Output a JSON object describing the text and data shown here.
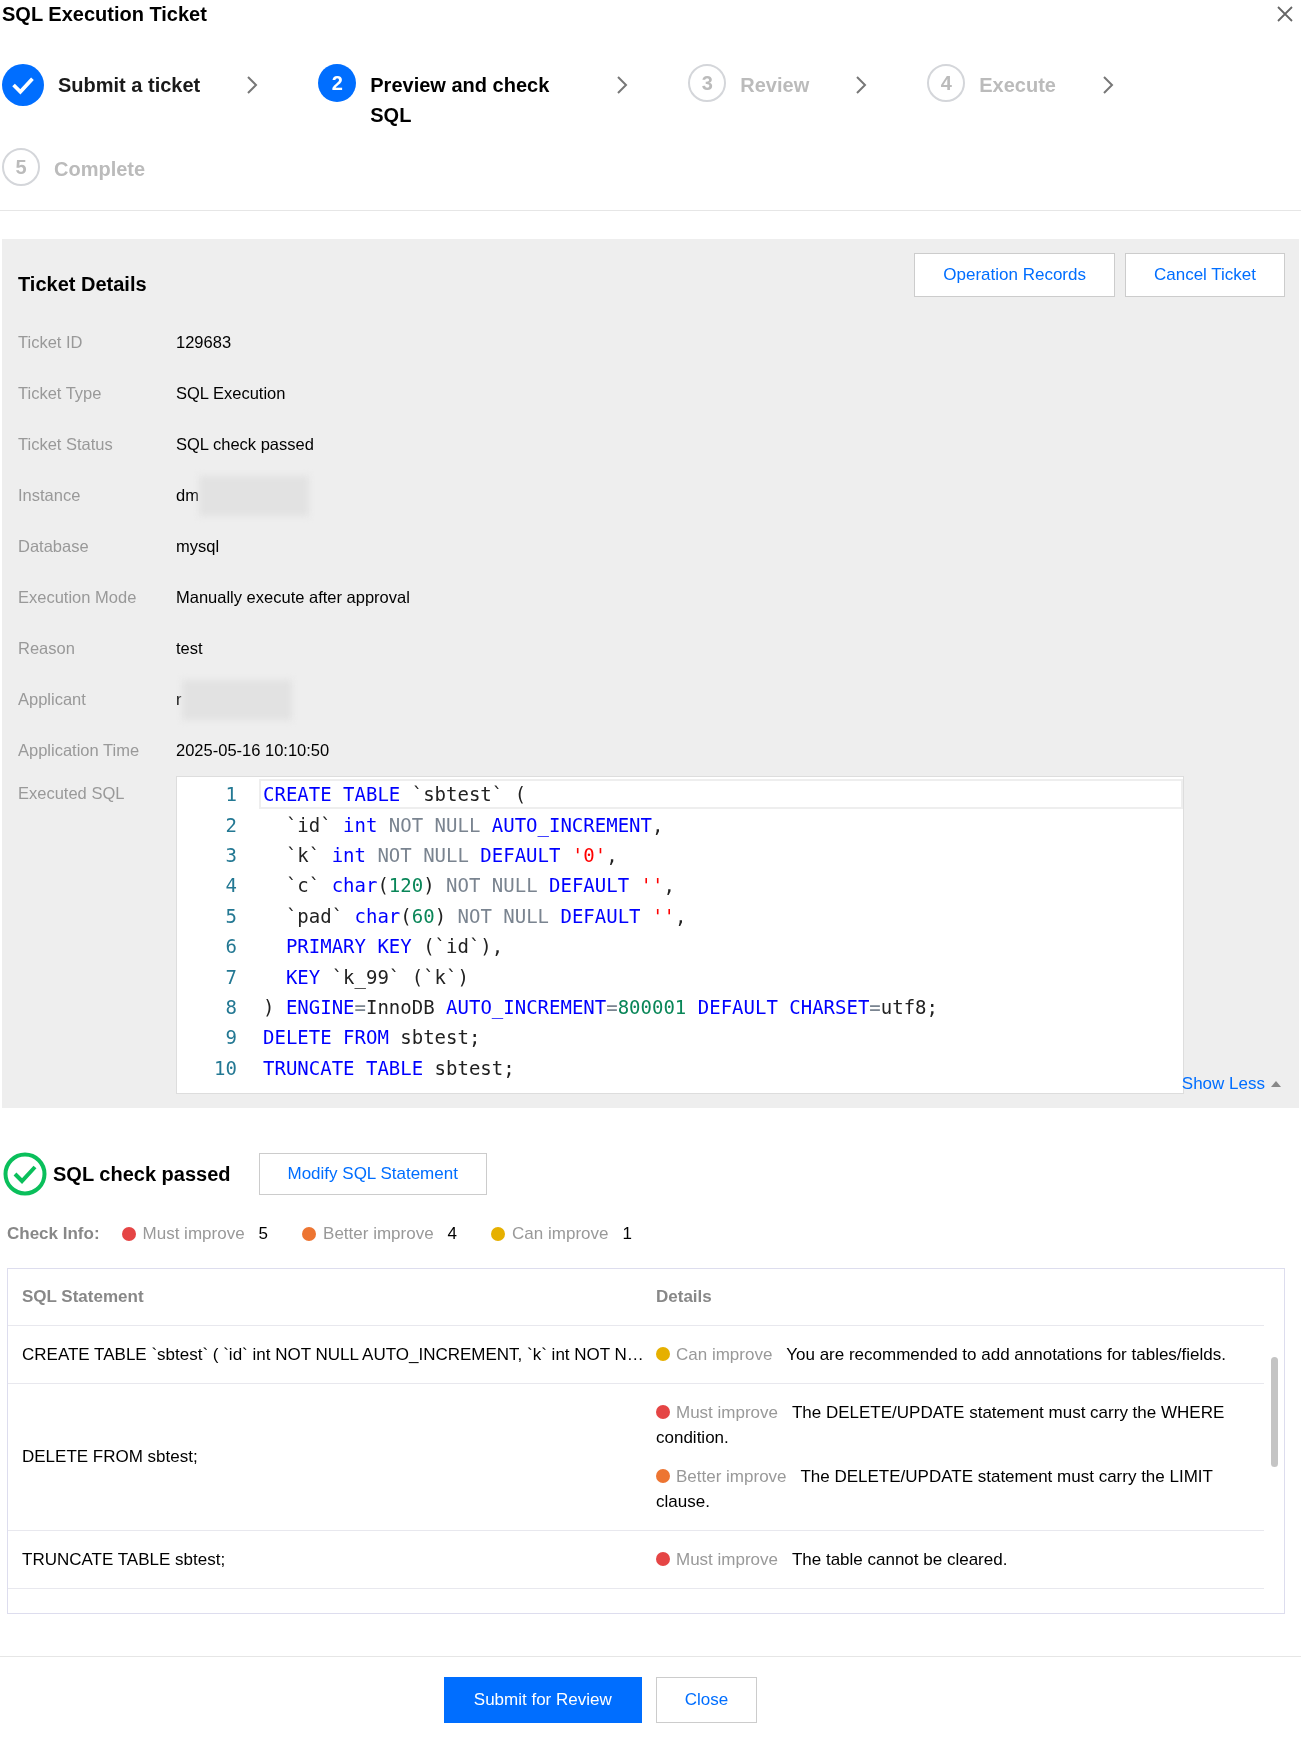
{
  "window": {
    "title": "SQL Execution Ticket"
  },
  "steps": [
    {
      "label": "Submit a ticket",
      "completed": true,
      "selected": false
    },
    {
      "number": "2",
      "label": "Preview and check SQL",
      "completed": false,
      "selected": true
    },
    {
      "number": "3",
      "label": "Review",
      "completed": false,
      "selected": false
    },
    {
      "number": "4",
      "label": "Execute",
      "completed": false,
      "selected": false
    },
    {
      "number": "5",
      "label": "Complete",
      "completed": false,
      "selected": false
    }
  ],
  "ticket_details": {
    "title": "Ticket Details",
    "buttons": [
      "Operation Records",
      "Cancel Ticket"
    ],
    "fields": [
      {
        "label": "Ticket ID",
        "value": "129683"
      },
      {
        "label": "Ticket Type",
        "value": "SQL Execution"
      },
      {
        "label": "Ticket Status",
        "value": "SQL check passed"
      },
      {
        "label": "Instance",
        "value": "dm",
        "redacted": true
      },
      {
        "label": "Database",
        "value": "mysql"
      },
      {
        "label": "Execution Mode",
        "value": "Manually execute after approval"
      },
      {
        "label": "Reason",
        "value": "test"
      },
      {
        "label": "Applicant",
        "value": "r",
        "redacted": true
      },
      {
        "label": "Application Time",
        "value": "2025-05-16 10:10:50"
      }
    ],
    "sql_label": "Executed SQL",
    "sql_lines": [
      {
        "number": "1",
        "active": true,
        "tokens": [
          {
            "kind": "kw",
            "text": "CREATE TABLE"
          },
          {
            "kind": "plain",
            "text": " `sbtest` ("
          }
        ]
      },
      {
        "number": "2",
        "active": false,
        "tokens": [
          {
            "kind": "plain",
            "text": "  `id` "
          },
          {
            "kind": "kw",
            "text": "int"
          },
          {
            "kind": "muted",
            "text": " NOT NULL "
          },
          {
            "kind": "kw",
            "text": "AUTO_INCREMENT"
          },
          {
            "kind": "plain",
            "text": ","
          }
        ]
      },
      {
        "number": "3",
        "active": false,
        "tokens": [
          {
            "kind": "plain",
            "text": "  `k` "
          },
          {
            "kind": "kw",
            "text": "int"
          },
          {
            "kind": "muted",
            "text": " NOT NULL "
          },
          {
            "kind": "kw",
            "text": "DEFAULT"
          },
          {
            "kind": "str",
            "text": " '0'"
          },
          {
            "kind": "plain",
            "text": ","
          }
        ]
      },
      {
        "number": "4",
        "active": false,
        "tokens": [
          {
            "kind": "plain",
            "text": "  `c` "
          },
          {
            "kind": "kw",
            "text": "char"
          },
          {
            "kind": "plain",
            "text": "("
          },
          {
            "kind": "num",
            "text": "120"
          },
          {
            "kind": "plain",
            "text": ")"
          },
          {
            "kind": "muted",
            "text": " NOT NULL "
          },
          {
            "kind": "kw",
            "text": "DEFAULT"
          },
          {
            "kind": "str",
            "text": " ''"
          },
          {
            "kind": "plain",
            "text": ","
          }
        ]
      },
      {
        "number": "5",
        "active": false,
        "tokens": [
          {
            "kind": "plain",
            "text": "  `pad` "
          },
          {
            "kind": "kw",
            "text": "char"
          },
          {
            "kind": "plain",
            "text": "("
          },
          {
            "kind": "num",
            "text": "60"
          },
          {
            "kind": "plain",
            "text": ")"
          },
          {
            "kind": "muted",
            "text": " NOT NULL "
          },
          {
            "kind": "kw",
            "text": "DEFAULT"
          },
          {
            "kind": "str",
            "text": " ''"
          },
          {
            "kind": "plain",
            "text": ","
          }
        ]
      },
      {
        "number": "6",
        "active": false,
        "tokens": [
          {
            "kind": "kw",
            "text": "  PRIMARY KEY"
          },
          {
            "kind": "plain",
            "text": " (`id`),"
          }
        ]
      },
      {
        "number": "7",
        "active": false,
        "tokens": [
          {
            "kind": "kw",
            "text": "  KEY"
          },
          {
            "kind": "plain",
            "text": " `k_99` (`k`)"
          }
        ]
      },
      {
        "number": "8",
        "active": false,
        "tokens": [
          {
            "kind": "plain",
            "text": ") "
          },
          {
            "kind": "kw",
            "text": "ENGINE"
          },
          {
            "kind": "muted",
            "text": "="
          },
          {
            "kind": "plain",
            "text": "InnoDB "
          },
          {
            "kind": "kw",
            "text": "AUTO_INCREMENT"
          },
          {
            "kind": "muted",
            "text": "="
          },
          {
            "kind": "num",
            "text": "800001"
          },
          {
            "kind": "kw",
            "text": " DEFAULT CHARSET"
          },
          {
            "kind": "muted",
            "text": "="
          },
          {
            "kind": "plain",
            "text": "utf8;"
          }
        ]
      },
      {
        "number": "9",
        "active": false,
        "tokens": [
          {
            "kind": "kw",
            "text": "DELETE FROM"
          },
          {
            "kind": "plain",
            "text": " sbtest;"
          }
        ]
      },
      {
        "number": "10",
        "active": false,
        "tokens": [
          {
            "kind": "kw",
            "text": "TRUNCATE TABLE"
          },
          {
            "kind": "plain",
            "text": " sbtest;"
          }
        ]
      }
    ],
    "show_less": "Show Less"
  },
  "check": {
    "result": "SQL check passed",
    "passed": true,
    "modify_button": "Modify SQL Statement",
    "info_label": "Check Info:",
    "counts": [
      {
        "label": "Must improve",
        "count": "5",
        "color": "#e54545"
      },
      {
        "label": "Better improve",
        "count": "4",
        "color": "#ed7532"
      },
      {
        "label": "Can improve",
        "count": "1",
        "color": "#e6b000"
      }
    ]
  },
  "table": {
    "columns": [
      "SQL Statement",
      "Details"
    ],
    "rows": [
      {
        "sql": "CREATE TABLE `sbtest` ( `id` int NOT NULL AUTO_INCREMENT, `k` int NOT N…",
        "issues": [
          {
            "level": "Can improve",
            "color": "#e6b000",
            "text": "You are recommended to add annotations for tables/fields."
          }
        ]
      },
      {
        "sql": "DELETE FROM sbtest;",
        "issues": [
          {
            "level": "Must improve",
            "color": "#e54545",
            "text": "The DELETE/UPDATE statement must carry the WHERE condition."
          },
          {
            "level": "Better improve",
            "color": "#ed7532",
            "text": "The DELETE/UPDATE statement must carry the LIMIT clause."
          }
        ]
      },
      {
        "sql": "TRUNCATE TABLE sbtest;",
        "issues": [
          {
            "level": "Must improve",
            "color": "#e54545",
            "text": "The table cannot be cleared."
          }
        ]
      }
    ]
  },
  "footer_buttons": [
    {
      "label": "Submit for Review",
      "kind": "primary"
    },
    {
      "label": "Close",
      "kind": "default"
    }
  ]
}
